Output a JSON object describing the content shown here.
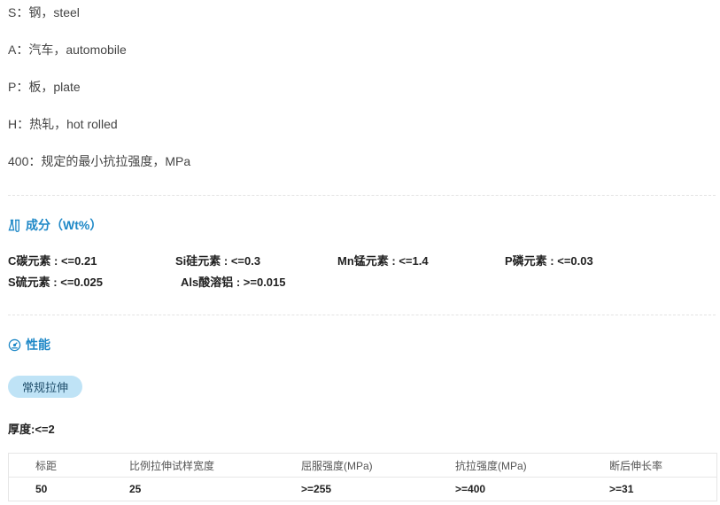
{
  "definitions": [
    "S：钢，steel",
    "A：汽车，automobile",
    "P：板，plate",
    "H：热轧，hot rolled",
    "400：规定的最小抗拉强度，MPa"
  ],
  "composition": {
    "title": "成分（Wt%）",
    "icon": "flask-icon",
    "items": [
      "C碳元素 : <=0.21",
      "Si硅元素 : <=0.3",
      "Mn锰元素 : <=1.4",
      "P磷元素 : <=0.03",
      "S硫元素 : <=0.025",
      "Als酸溶铝 : >=0.015"
    ]
  },
  "properties": {
    "title": "性能",
    "icon": "gauge-icon",
    "tab_label": "常规拉伸",
    "thickness": "厚度:<=2",
    "table": {
      "headers": [
        "标距",
        "比例拉伸试样宽度",
        "屈服强度(MPa)",
        "抗拉强度(MPa)",
        "断后伸长率"
      ],
      "rows": [
        [
          "50",
          "25",
          ">=255",
          ">=400",
          ">=31"
        ]
      ]
    }
  },
  "colors": {
    "accent": "#1e88c7",
    "pill_bg": "#bfe3f6"
  }
}
